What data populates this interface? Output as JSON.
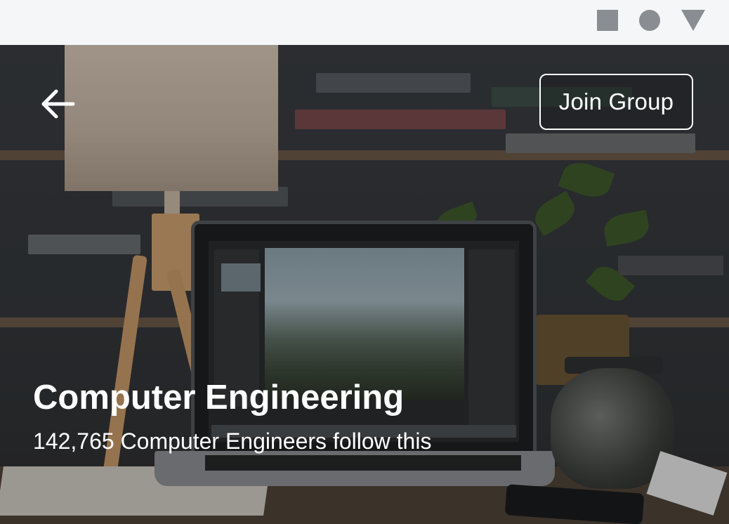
{
  "status_bar": {
    "icons": [
      "square-icon",
      "circle-icon",
      "triangle-icon"
    ],
    "icon_color": "#8a8d91",
    "background_color": "#f4f6f8"
  },
  "header": {
    "back_icon": "arrow-left-icon",
    "join_button_label": "Join Group"
  },
  "group": {
    "title": "Computer Engineering",
    "follower_text": "142,765 Computer Engineers follow this"
  },
  "hero_image": {
    "subject": "laptop-on-desk-photo"
  }
}
